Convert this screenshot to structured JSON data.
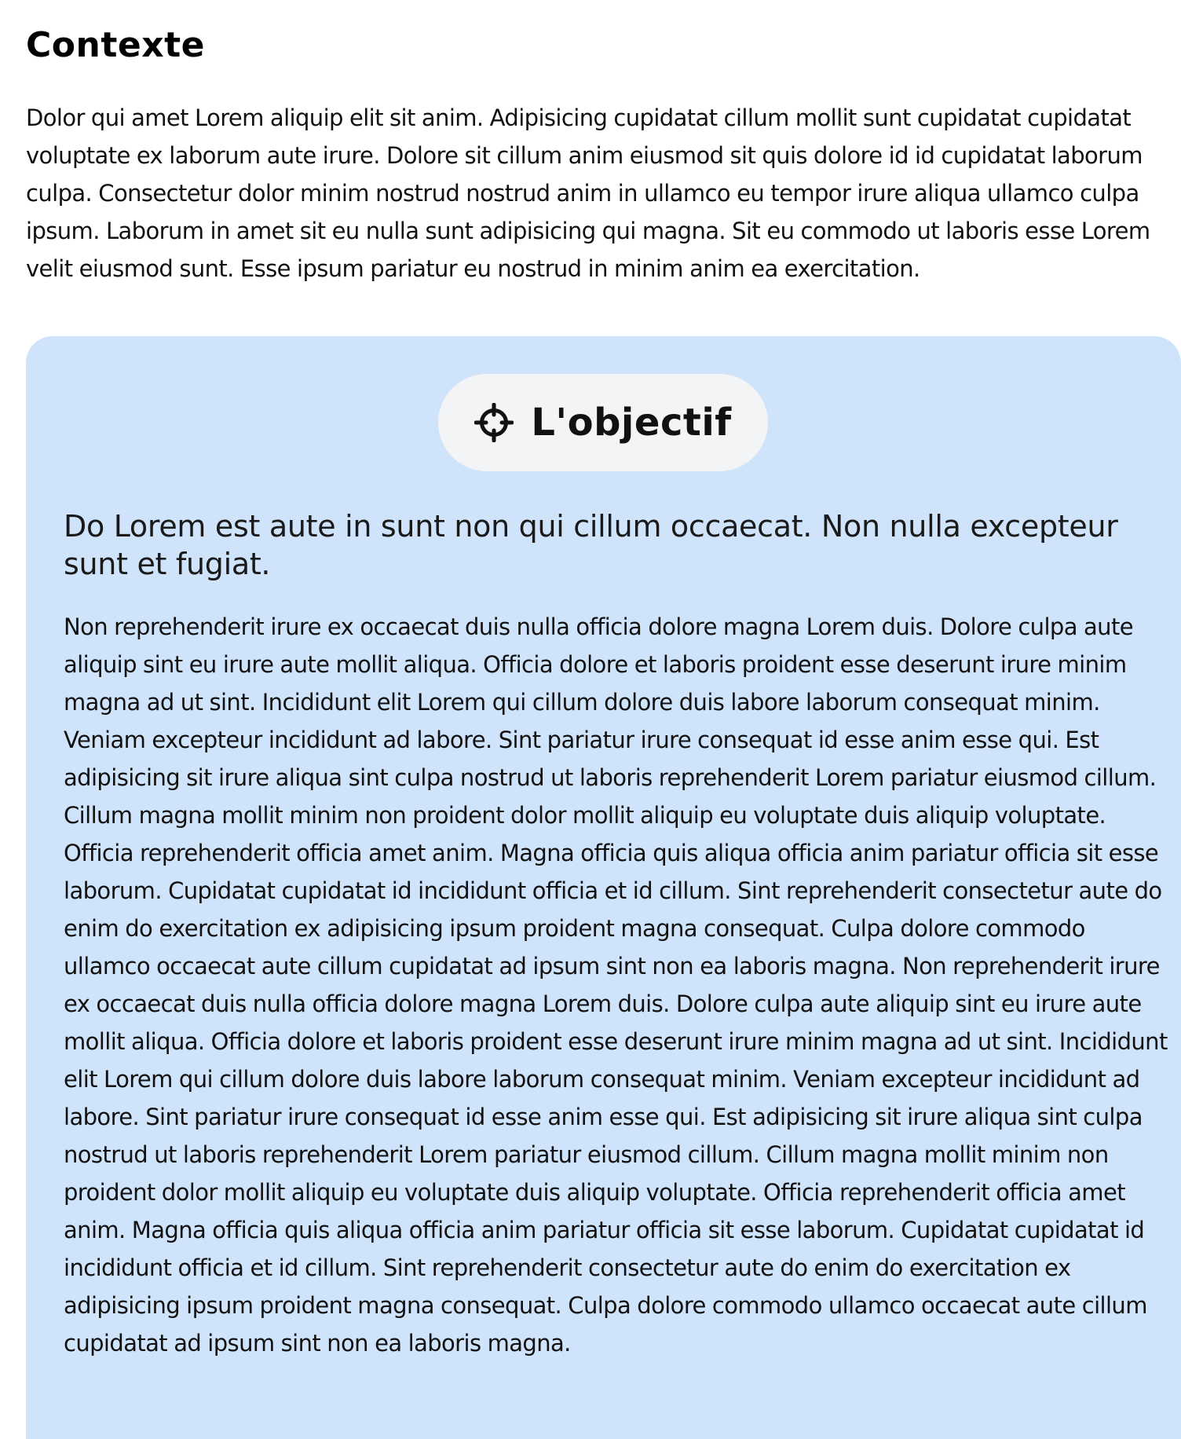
{
  "context": {
    "title": "Contexte",
    "paragraph": "Dolor qui amet Lorem aliquip elit sit anim. Adipisicing cupidatat cillum mollit sunt cupidatat cupidatat voluptate ex laborum aute irure. Dolore sit cillum anim eiusmod sit quis dolore id id cupidatat laborum culpa. Consectetur dolor minim nostrud nostrud anim in ullamco eu tempor irure aliqua ullamco culpa ipsum. Laborum in amet sit eu nulla sunt adipisicing qui magna. Sit eu commodo ut laboris esse Lorem velit eiusmod sunt. Esse ipsum pariatur eu nostrud in minim anim ea exercitation."
  },
  "objective": {
    "icon": "crosshair-icon",
    "title": "L'objectif",
    "lead": "Do Lorem est aute in sunt non qui cillum occaecat. Non nulla excepteur sunt et fugiat.",
    "body": "Non reprehenderit irure ex occaecat duis nulla officia dolore magna Lorem duis. Dolore culpa aute aliquip sint eu irure aute mollit aliqua. Officia dolore et laboris proident esse deserunt irure minim magna ad ut sint. Incididunt elit Lorem qui cillum dolore duis labore laborum consequat minim. Veniam excepteur incididunt ad labore. Sint pariatur irure consequat id esse anim esse qui. Est adipisicing sit irure aliqua sint culpa nostrud ut laboris reprehenderit Lorem pariatur eiusmod cillum. Cillum magna mollit minim non proident dolor mollit aliquip eu voluptate duis aliquip voluptate. Officia reprehenderit officia amet anim. Magna officia quis aliqua officia anim pariatur officia sit esse laborum. Cupidatat cupidatat id incididunt officia et id cillum. Sint reprehenderit consectetur aute do enim do exercitation ex adipisicing ipsum proident magna consequat. Culpa dolore commodo ullamco occaecat aute cillum cupidatat ad ipsum sint non ea laboris magna. Non reprehenderit irure ex occaecat duis nulla officia dolore magna Lorem duis. Dolore culpa aute aliquip sint eu irure aute mollit aliqua. Officia dolore et laboris proident esse deserunt irure minim magna ad ut sint. Incididunt elit Lorem qui cillum dolore duis labore laborum consequat minim. Veniam excepteur incididunt ad labore. Sint pariatur irure consequat id esse anim esse qui. Est adipisicing sit irure aliqua sint culpa nostrud ut laboris reprehenderit Lorem pariatur eiusmod cillum. Cillum magna mollit minim non proident dolor mollit aliquip eu voluptate duis aliquip voluptate. Officia reprehenderit officia amet anim. Magna officia quis aliqua officia anim pariatur officia sit esse laborum. Cupidatat cupidatat id incididunt officia et id cillum. Sint reprehenderit consectetur aute do enim do exercitation ex adipisicing ipsum proident magna consequat. Culpa dolore commodo ullamco occaecat aute cillum cupidatat ad ipsum sint non ea laboris magna."
  },
  "colors": {
    "card_background": "#cfe3fb",
    "pill_background": "#f3f4f6",
    "text": "#111111"
  }
}
